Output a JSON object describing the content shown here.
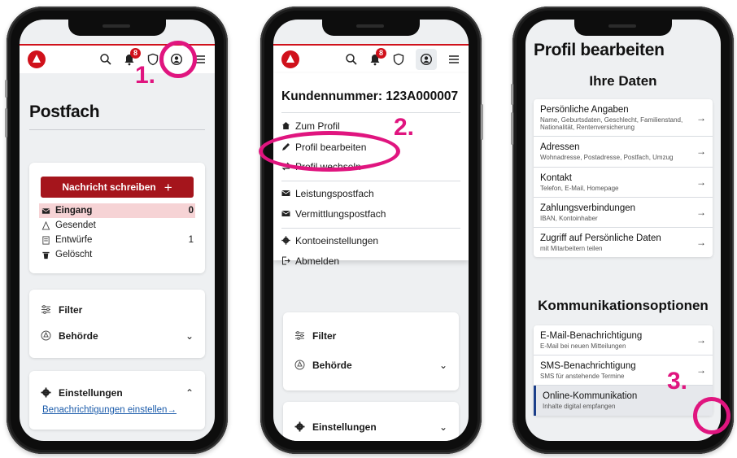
{
  "colors": {
    "brand_red": "#d0111b",
    "button_red": "#a5151c",
    "highlight_pink": "#e0157f",
    "link_blue": "#1c5cab",
    "selected_bg": "#f6d3d5"
  },
  "steps": {
    "one": "1.",
    "two": "2.",
    "three": "3."
  },
  "header": {
    "notification_count": "8",
    "icons": [
      "search-icon",
      "bell-icon",
      "shield-icon",
      "account-icon",
      "menu-icon"
    ]
  },
  "phone1": {
    "title": "Postfach",
    "compose_label": "Nachricht schreiben",
    "compose_plus": "+",
    "mailboxes": [
      {
        "label": "Eingang",
        "count": "0",
        "icon": "envelope-icon"
      },
      {
        "label": "Gesendet",
        "count": "",
        "icon": "send-icon"
      },
      {
        "label": "Entwürfe",
        "count": "1",
        "icon": "draft-icon"
      },
      {
        "label": "Gelöscht",
        "count": "",
        "icon": "trash-icon"
      }
    ],
    "filter_label": "Filter",
    "authority_label": "Behörde",
    "settings_label": "Einstellungen",
    "notifications_link": "Benachrichtigungen einstellen→"
  },
  "phone2": {
    "customer_number": "Kundennummer: 123A000007",
    "menu_items": [
      {
        "label": "Zum Profil",
        "icon": "home-icon"
      },
      {
        "label": "Profil bearbeiten",
        "icon": "pencil-icon"
      },
      {
        "label": "Profil wechseln",
        "icon": "switch-icon"
      },
      {
        "label": "Leistungspostfach",
        "icon": "envelope-icon"
      },
      {
        "label": "Vermittlungspostfach",
        "icon": "envelope-icon"
      },
      {
        "label": "Kontoeinstellungen",
        "icon": "gear-icon"
      },
      {
        "label": "Abmelden",
        "icon": "logout-icon"
      }
    ],
    "filter_label": "Filter",
    "authority_label": "Behörde",
    "settings_label": "Einstellungen"
  },
  "phone3": {
    "title": "Profil bearbeiten",
    "section1": "Ihre Daten",
    "data_items": [
      {
        "title": "Persönliche Angaben",
        "sub": "Name, Geburtsdaten, Geschlecht, Familienstand, Nationalität, Rentenversicherung"
      },
      {
        "title": "Adressen",
        "sub": "Wohnadresse, Postadresse, Postfach, Umzug"
      },
      {
        "title": "Kontakt",
        "sub": "Telefon, E-Mail, Homepage"
      },
      {
        "title": "Zahlungsverbindungen",
        "sub": "IBAN, Kontoinhaber"
      },
      {
        "title": "Zugriff auf Persönliche Daten",
        "sub": "mit Mitarbeitern teilen"
      }
    ],
    "section2": "Kommunikationsoptionen",
    "comm_items": [
      {
        "title": "E-Mail-Benachrichtigung",
        "sub": "E-Mail bei neuen Mitteilungen"
      },
      {
        "title": "SMS-Benachrichtigung",
        "sub": "SMS für anstehende Termine"
      },
      {
        "title": "Online-Kommunikation",
        "sub": "Inhalte digital empfangen"
      }
    ],
    "arrow": "→"
  }
}
